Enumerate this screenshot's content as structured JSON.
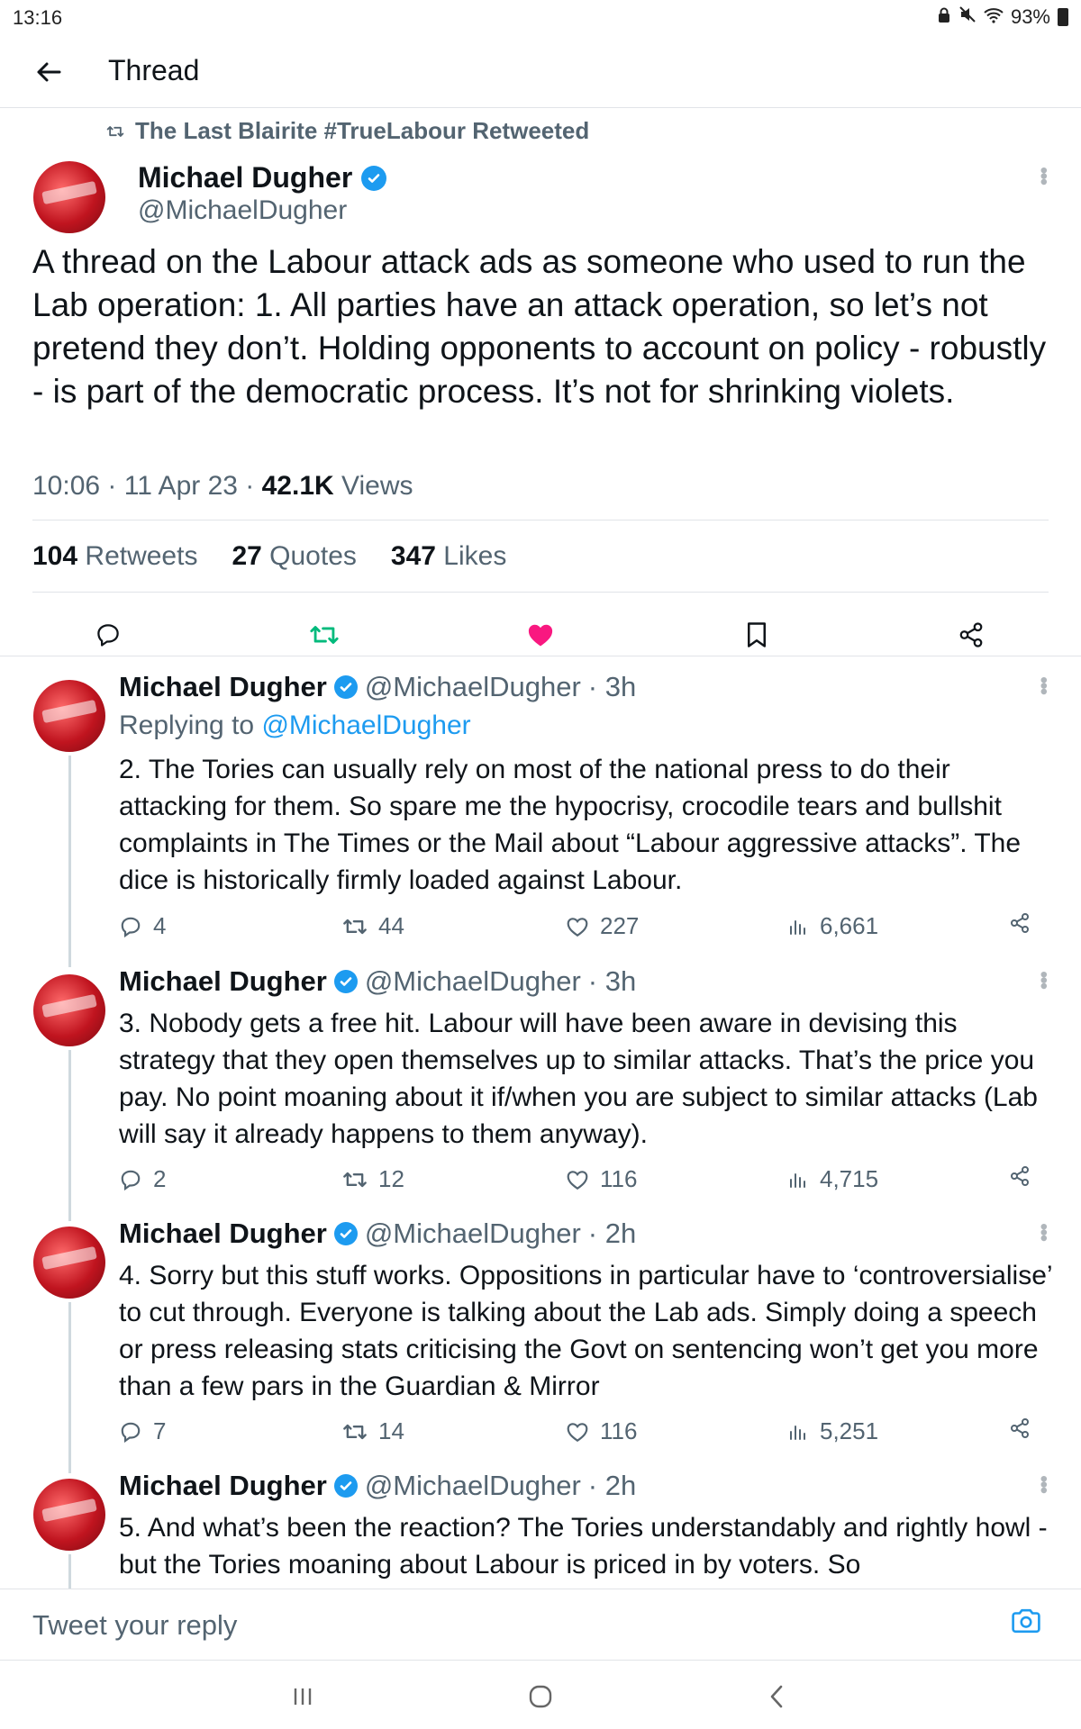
{
  "status_bar": {
    "time": "13:16",
    "battery": "93%"
  },
  "header": {
    "title": "Thread"
  },
  "retweet_banner": "The Last Blairite #TrueLabour Retweeted",
  "main_tweet": {
    "name": "Michael Dugher",
    "handle": "@MichaelDugher",
    "text": "A thread on the Labour attack ads as someone who used to run the Lab operation: 1. All parties have an attack operation, so let’s not pretend they don’t. Holding opponents to account on policy - robustly - is part of the democratic process. It’s not for shrinking violets.",
    "time": "10:06 · 11 Apr 23 · ",
    "views_count": "42.1K",
    "views_label": " Views",
    "retweets_count": "104",
    "retweets_label": " Retweets",
    "quotes_count": "27",
    "quotes_label": " Quotes",
    "likes_count": "347",
    "likes_label": " Likes"
  },
  "replies": [
    {
      "name": "Michael Dugher",
      "handle": "@MichaelDugher",
      "age": "· 3h",
      "replying_prefix": "Replying to ",
      "replying_to": "@MichaelDugher",
      "text": "2. The Tories can usually rely on most of the national press to do their attacking for them. So spare me the hypocrisy, crocodile tears and bullshit complaints in The Times or the Mail about “Labour aggressive attacks”. The dice is historically firmly loaded against Labour.",
      "replies": "4",
      "retweets": "44",
      "likes": "227",
      "views": "6,661"
    },
    {
      "name": "Michael Dugher",
      "handle": "@MichaelDugher",
      "age": "· 3h",
      "text": "3. Nobody gets a free hit. Labour will have been aware in devising this strategy that they open themselves up to similar attacks. That’s the price you pay. No point moaning about it if/when you are subject to similar attacks (Lab will say it already happens to them anyway).",
      "replies": "2",
      "retweets": "12",
      "likes": "116",
      "views": "4,715"
    },
    {
      "name": "Michael Dugher",
      "handle": "@MichaelDugher",
      "age": "· 2h",
      "text": "4. Sorry but this stuff works. Oppositions in particular have to ‘controversialise’ to cut through. Everyone is talking about the Lab ads. Simply doing a speech or press releasing stats criticising the Govt on sentencing won’t get you more than a few pars in the Guardian & Mirror",
      "replies": "7",
      "retweets": "14",
      "likes": "116",
      "views": "5,251"
    },
    {
      "name": "Michael Dugher",
      "handle": "@MichaelDugher",
      "age": "· 2h",
      "text": "5. And what’s been the reaction? The Tories understandably and rightly howl - but the Tories moaning about Labour is priced in by voters. So"
    }
  ],
  "reply_bar": {
    "placeholder": "Tweet your reply"
  },
  "colors": {
    "accent": "#1d9bf0",
    "like": "#f91880",
    "retweet": "#00ba7c",
    "muted": "#536471"
  },
  "icons": [
    "back-arrow-icon",
    "retweet-icon",
    "verified-icon",
    "more-icon",
    "reply-icon",
    "like-icon",
    "bookmark-icon",
    "share-icon",
    "views-icon",
    "camera-icon"
  ]
}
